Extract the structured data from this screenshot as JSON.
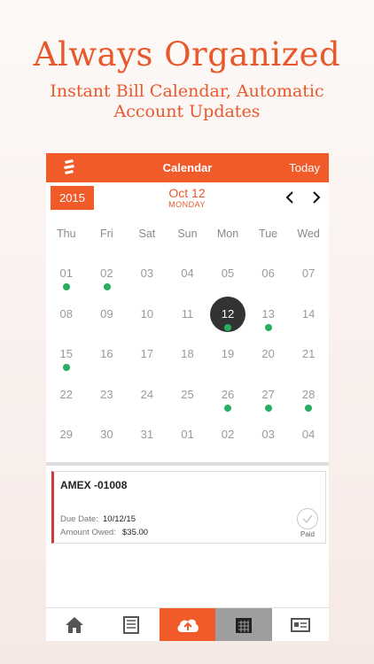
{
  "headline": "Always Organized",
  "subline": "Instant Bill Calendar, Automatic Account Updates",
  "topbar": {
    "title": "Calendar",
    "today_label": "Today",
    "accent": "#f15a29"
  },
  "calendar": {
    "year_label": "2015",
    "month_label": "Oct 12",
    "weekday_label": "MONDAY",
    "weekdays": [
      "Thu",
      "Fri",
      "Sat",
      "Sun",
      "Mon",
      "Tue",
      "Wed"
    ],
    "weeks": [
      [
        {
          "d": "01",
          "dot": true
        },
        {
          "d": "02",
          "dot": true
        },
        {
          "d": "03",
          "dot": false
        },
        {
          "d": "04",
          "dot": false
        },
        {
          "d": "05",
          "dot": false
        },
        {
          "d": "06",
          "dot": false
        },
        {
          "d": "07",
          "dot": false
        }
      ],
      [
        {
          "d": "08",
          "dot": false
        },
        {
          "d": "09",
          "dot": false
        },
        {
          "d": "10",
          "dot": false
        },
        {
          "d": "11",
          "dot": false
        },
        {
          "d": "12",
          "dot": true,
          "selected": true
        },
        {
          "d": "13",
          "dot": true
        },
        {
          "d": "14",
          "dot": false
        }
      ],
      [
        {
          "d": "15",
          "dot": true
        },
        {
          "d": "16",
          "dot": false
        },
        {
          "d": "17",
          "dot": false
        },
        {
          "d": "18",
          "dot": false
        },
        {
          "d": "19",
          "dot": false
        },
        {
          "d": "20",
          "dot": false
        },
        {
          "d": "21",
          "dot": false
        }
      ],
      [
        {
          "d": "22",
          "dot": false
        },
        {
          "d": "23",
          "dot": false
        },
        {
          "d": "24",
          "dot": false
        },
        {
          "d": "25",
          "dot": false
        },
        {
          "d": "26",
          "dot": true
        },
        {
          "d": "27",
          "dot": true
        },
        {
          "d": "28",
          "dot": true
        }
      ],
      [
        {
          "d": "29",
          "dot": false
        },
        {
          "d": "30",
          "dot": false
        },
        {
          "d": "31",
          "dot": false
        },
        {
          "d": "01",
          "dot": false
        },
        {
          "d": "02",
          "dot": false
        },
        {
          "d": "03",
          "dot": false
        },
        {
          "d": "04",
          "dot": false
        }
      ]
    ],
    "dot_color": "#27ae60"
  },
  "bill": {
    "name": "AMEX -01008",
    "due_label": "Due Date:",
    "due_value": "10/12/15",
    "owed_label": "Amount Owed:",
    "owed_value": "$35.00",
    "status": "Paid"
  },
  "tabs": [
    "home-icon",
    "statements-icon",
    "cloud-upload-icon",
    "calendar-icon",
    "card-icon"
  ]
}
